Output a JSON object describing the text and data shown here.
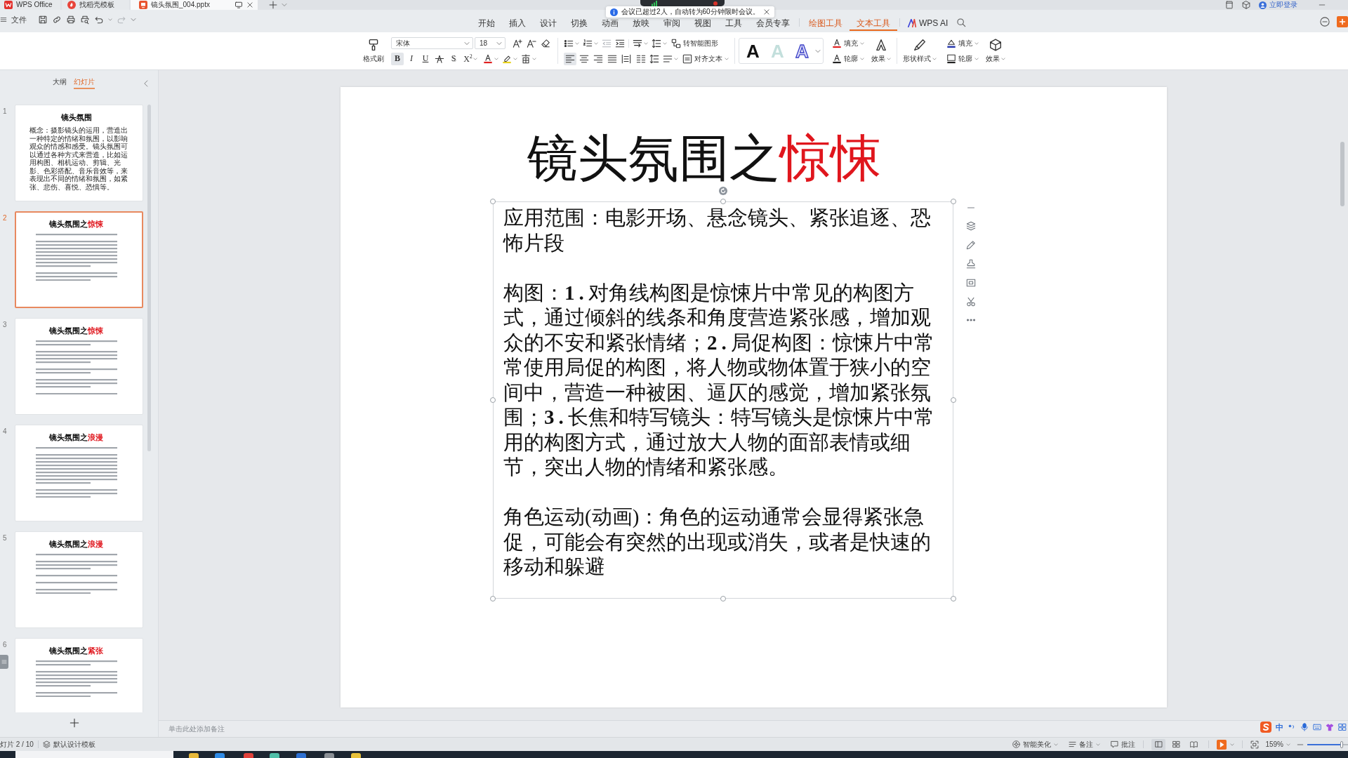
{
  "title_tabs": [
    {
      "label": "WPS Office",
      "kind": "home",
      "selected": false
    },
    {
      "label": "找稻壳模板",
      "kind": "template",
      "selected": false
    },
    {
      "label": "镜头氛围_004.pptx",
      "kind": "presentation",
      "selected": true
    }
  ],
  "account": {
    "login": "立即登录"
  },
  "notification": {
    "text": "会议已超过2人，自动转为60分钟限时会议。"
  },
  "menu": {
    "file": "文件",
    "tabs": [
      {
        "label": "开始",
        "contextual": false,
        "selected": false
      },
      {
        "label": "插入",
        "contextual": false,
        "selected": false
      },
      {
        "label": "设计",
        "contextual": false,
        "selected": false
      },
      {
        "label": "切换",
        "contextual": false,
        "selected": false
      },
      {
        "label": "动画",
        "contextual": false,
        "selected": false
      },
      {
        "label": "放映",
        "contextual": false,
        "selected": false
      },
      {
        "label": "审阅",
        "contextual": false,
        "selected": false
      },
      {
        "label": "视图",
        "contextual": false,
        "selected": false
      },
      {
        "label": "工具",
        "contextual": false,
        "selected": false
      },
      {
        "label": "会员专享",
        "contextual": false,
        "selected": false
      },
      {
        "label": "绘图工具",
        "contextual": true,
        "selected": false
      },
      {
        "label": "文本工具",
        "contextual": true,
        "selected": true
      }
    ],
    "ai": "WPS AI"
  },
  "ribbon": {
    "format_painter": "格式刷",
    "font_name": "宋体",
    "font_size": "18",
    "font_styles": [
      {
        "kind": "bold",
        "label": "B",
        "selected": true
      },
      {
        "kind": "italic",
        "label": "I",
        "selected": false
      },
      {
        "kind": "underline",
        "label": "U",
        "selected": false
      },
      {
        "kind": "strike",
        "selected": false
      },
      {
        "kind": "shadow",
        "label": "S",
        "selected": false
      },
      {
        "kind": "superscript",
        "label": "X$^{2}$",
        "selected": false
      }
    ],
    "alignment": [
      {
        "kind": "left",
        "selected": true
      },
      {
        "kind": "center",
        "selected": false
      },
      {
        "kind": "right",
        "selected": false
      },
      {
        "kind": "justify",
        "selected": false
      },
      {
        "kind": "distributed",
        "selected": false
      }
    ],
    "smart_art": "转智能图形",
    "align_text": "对齐文本",
    "text_styles": [
      {
        "label": "A",
        "kind": "solid"
      },
      {
        "label": "A",
        "kind": "pale"
      },
      {
        "label": "A",
        "kind": "outline"
      }
    ],
    "text_fill": "填充",
    "text_outline": "轮廓",
    "text_effect": "效果",
    "shape_style": "形状样式",
    "shape_fill": "填充",
    "shape_outline": "轮廓",
    "shape_effect": "效果"
  },
  "side_panel": {
    "tabs": [
      {
        "label": "大纲",
        "selected": false
      },
      {
        "label": "幻灯片",
        "selected": true
      }
    ],
    "thumbnails": [
      {
        "number": "1",
        "title": "镜头氛围",
        "body": "概念：摄影镜头的运用，营造出一种特定的情绪和氛围，以影响观众的情感和感受。镜头氛围可以通过各种方式来营造，比如运用构图、相机运动、剪辑、光影、色彩搭配、音乐音效等，来表现出不同的情绪和氛围，如紧张、悲伤、喜悦、恐惧等。",
        "selected": false
      },
      {
        "number": "2",
        "title": "镜头氛围之",
        "accent": "惊悚",
        "selected": true
      },
      {
        "number": "3",
        "title": "镜头氛围之",
        "accent": "惊悚",
        "selected": false
      },
      {
        "number": "4",
        "title": "镜头氛围之",
        "accent": "浪漫",
        "selected": false
      },
      {
        "number": "5",
        "title": "镜头氛围之",
        "accent": "浪漫",
        "selected": false
      },
      {
        "number": "6",
        "title": "镜头氛围之",
        "accent": "紧张",
        "selected": false
      }
    ]
  },
  "slide": {
    "title": "镜头氛围之",
    "title_accent": "惊悚",
    "paragraphs": [
      "应用范围：电影开场、悬念镜头、紧张追逐、恐怖片段",
      "构图：**1.**对角线构图是惊悚片中常见的构图方式，通过倾斜的线条和角度营造紧张感，增加观众的不安和紧张情绪；**2.**局促构图：惊悚片中常常使用局促的构图，将人物或物体置于狭小的空间中，营造一种被困、逼仄的感觉，增加紧张氛围；**3.**长焦和特写镜头：特写镜头是惊悚片中常用的构图方式，通过放大人物的面部表情或细节，突出人物的情绪和紧张感。",
      "角色运动(动画)：角色的运动通常会显得紧张急促，可能会有突然的出现或消失，或者是快速的移动和躲避"
    ]
  },
  "notes": {
    "placeholder": "单击此处添加备注"
  },
  "status_bar": {
    "slide_counter": "灯片 2 / 10",
    "template": "默认设计模板",
    "beautify": "智能美化",
    "notes": "备注",
    "comments": "批注",
    "views": [
      {
        "kind": "normal",
        "selected": true
      },
      {
        "kind": "sorter",
        "selected": false
      },
      {
        "kind": "reading",
        "selected": false
      }
    ],
    "zoom": "159%",
    "zoom_slider": {
      "level": 0.85
    }
  },
  "ime": {
    "mode": "中"
  }
}
